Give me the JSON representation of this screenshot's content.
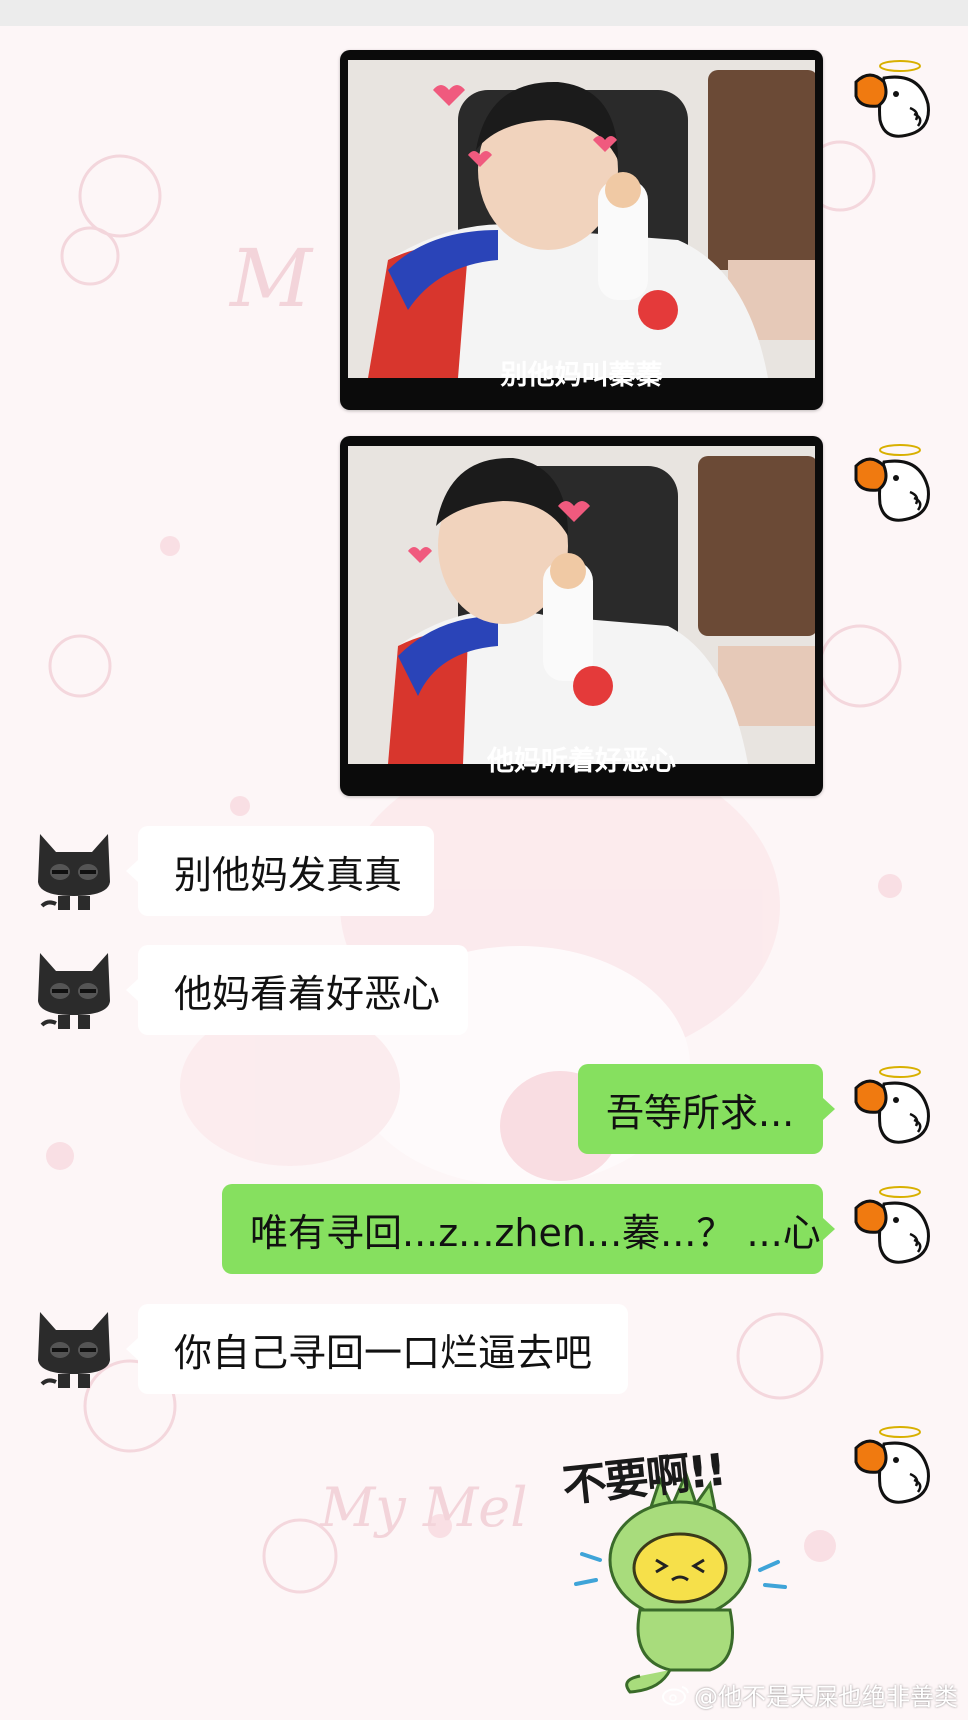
{
  "chat": {
    "messages": [
      {
        "side": "right",
        "type": "image",
        "caption": "别他妈叫蓁蓁"
      },
      {
        "side": "right",
        "type": "image",
        "caption": "他妈听着好恶心"
      },
      {
        "side": "left",
        "type": "text",
        "text": "别他妈发真真"
      },
      {
        "side": "left",
        "type": "text",
        "text": "他妈看着好恶心"
      },
      {
        "side": "right",
        "type": "text",
        "text": "吾等所求..."
      },
      {
        "side": "right",
        "type": "text",
        "text": "唯有寻回...z...zhen...蓁...？ ...心"
      },
      {
        "side": "left",
        "type": "text",
        "text": "你自己寻回一口烂逼去吧"
      },
      {
        "side": "right",
        "type": "sticker",
        "text": "不要啊!!"
      }
    ]
  },
  "watermark": "@他不是天屎也绝非善类",
  "colors": {
    "right_bubble": "#86e05f",
    "left_bubble": "#ffffff",
    "image_frame": "#0b0b0b"
  },
  "icons": {
    "self_avatar": "duck-with-halo-icon",
    "other_avatar": "black-cat-icon",
    "watermark_logo": "weibo-icon"
  }
}
